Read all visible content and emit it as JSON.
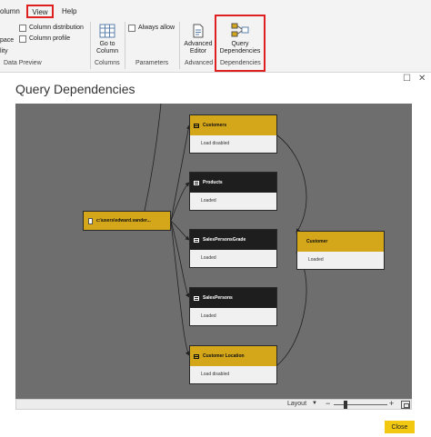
{
  "ribbon": {
    "tabs": {
      "column": "olumn",
      "view": "View",
      "help": "Help"
    },
    "data_preview": {
      "space_fragment": "pace",
      "quality_fragment": "lity",
      "column_distribution": "Column distribution",
      "column_profile": "Column profile",
      "group_label": "Data Preview"
    },
    "columns": {
      "go_to_column": "Go to Column",
      "group_label": "Columns"
    },
    "parameters": {
      "always_allow": "Always allow",
      "group_label": "Parameters"
    },
    "advanced": {
      "advanced_editor": "Advanced Editor",
      "group_label": "Advanced"
    },
    "dependencies": {
      "query_dependencies": "Query Dependencies",
      "group_label": "Dependencies"
    }
  },
  "dialog": {
    "title": "Query Dependencies",
    "source": {
      "label": "c:\\users\\edward.vander..."
    },
    "queries": [
      {
        "name": "Customers",
        "status": "Load disabled"
      },
      {
        "name": "Products",
        "status": "Loaded"
      },
      {
        "name": "SalesPersonsGrade",
        "status": "Loaded"
      },
      {
        "name": "SalesPersons",
        "status": "Loaded"
      },
      {
        "name": "Customer Location",
        "status": "Load disabled"
      }
    ],
    "output": {
      "name": "Customer",
      "status": "Loaded"
    },
    "bottombar": {
      "layout_label": "Layout",
      "zoom_minus": "−",
      "zoom_plus": "+"
    },
    "close_label": "Close"
  },
  "colors": {
    "gold": "#d4a61a",
    "dark": "#1e1e1e",
    "canvas": "#6e6e6e",
    "close_button": "#f2c811",
    "highlight": "#e02020"
  }
}
